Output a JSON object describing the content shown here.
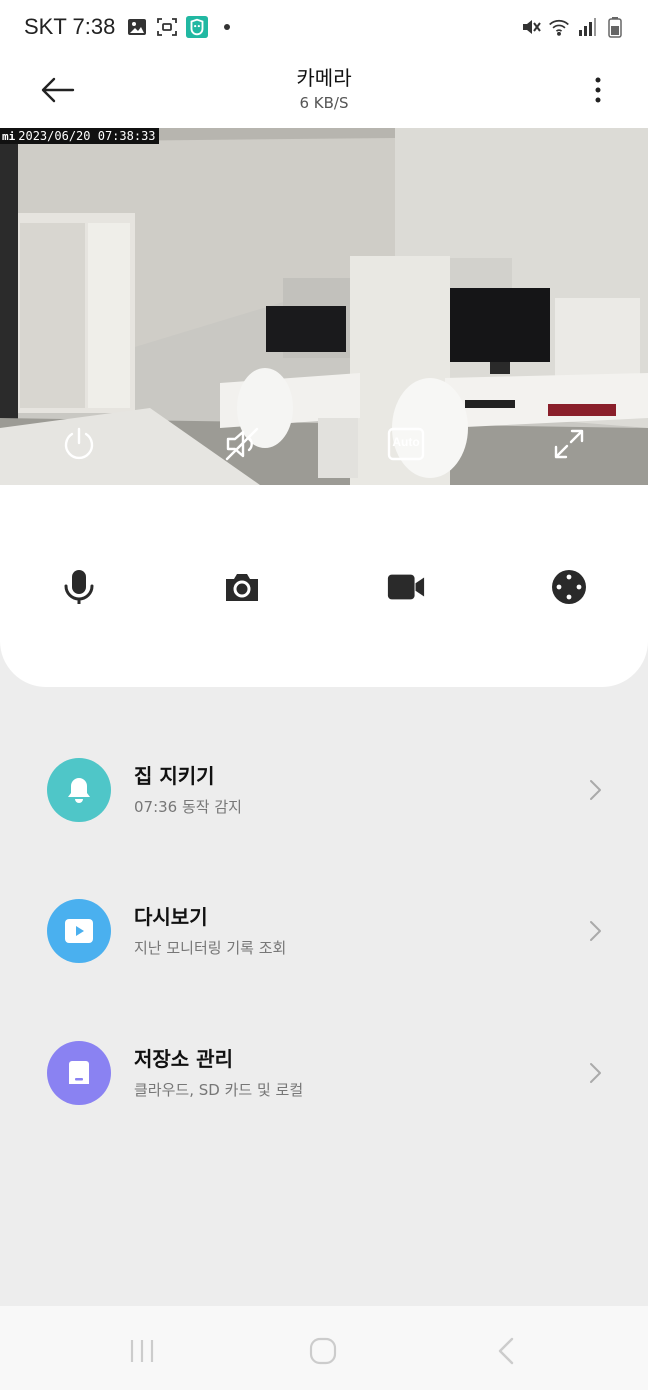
{
  "status_bar": {
    "carrier_time": "SKT 7:38",
    "icons_left": [
      "gallery-icon",
      "screenshot-icon",
      "mi-home-app-icon",
      "notification-dot-icon"
    ],
    "icons_right": [
      "mute-icon",
      "wifi-icon",
      "signal-icon",
      "battery-icon"
    ]
  },
  "app_bar": {
    "title": "카메라",
    "subtitle": "6 KB/S"
  },
  "camera": {
    "timestamp": "2023/06/20  07:38:33",
    "logo": "mi",
    "quality_label": "Auto"
  },
  "list": [
    {
      "title": "집 지키기",
      "subtitle": "07:36 동작 감지",
      "icon": "bell-icon",
      "color": "#4fc6c8"
    },
    {
      "title": "다시보기",
      "subtitle": "지난 모니터링 기록 조회",
      "icon": "play-icon",
      "color": "#4ab0ef"
    },
    {
      "title": "저장소 관리",
      "subtitle": "클라우드, SD 카드 및 로컬",
      "icon": "storage-icon",
      "color": "#8a82f2"
    }
  ],
  "colors": {
    "accent_teal": "#4fc6c8",
    "accent_blue": "#4ab0ef",
    "accent_purple": "#8a82f2",
    "background": "#ededed"
  }
}
